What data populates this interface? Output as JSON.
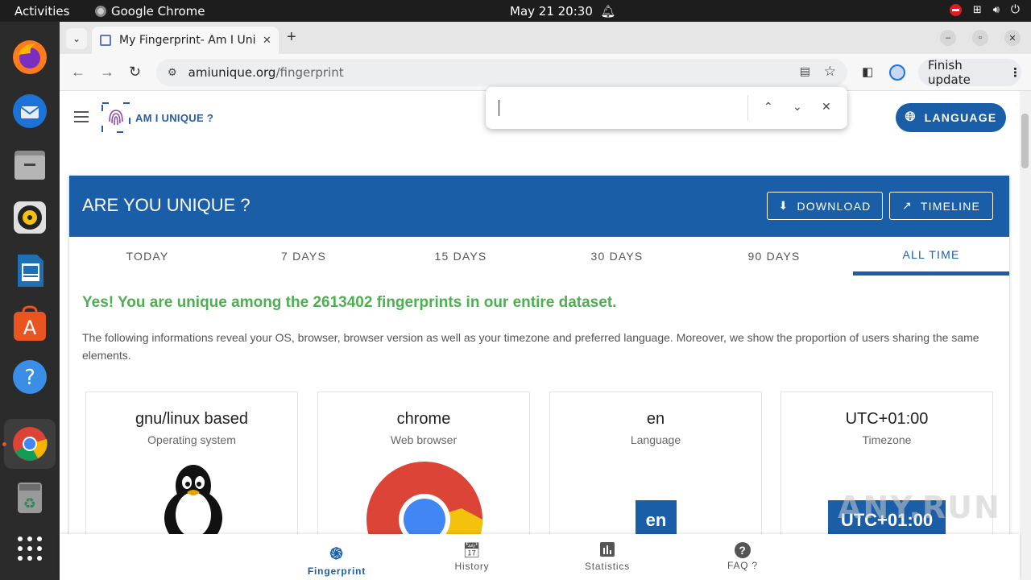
{
  "topbar": {
    "activities": "Activities",
    "app_name": "Google Chrome",
    "clock": "May 21  20:30"
  },
  "browser": {
    "tab_title": "My Fingerprint- Am I Uni",
    "url_host": "amiunique.org",
    "url_path": "/fingerprint",
    "finish_update": "Finish update"
  },
  "site": {
    "logo_text": "AM I UNIQUE ?",
    "language_label": "LANGUAGE"
  },
  "banner": {
    "title": "ARE YOU UNIQUE ?",
    "download_label": "DOWNLOAD",
    "timeline_label": "TIMELINE"
  },
  "period_tabs": [
    "TODAY",
    "7 DAYS",
    "15 DAYS",
    "30 DAYS",
    "90 DAYS",
    "ALL TIME"
  ],
  "active_tab": "ALL TIME",
  "result": {
    "headline": "Yes! You are unique among the 2613402 fingerprints in our entire dataset.",
    "description": "The following informations reveal your OS, browser, browser version as well as your timezone and preferred language. Moreover, we show the proportion of users sharing the same elements."
  },
  "cards": [
    {
      "value": "gnu/linux based",
      "label": "Operating system"
    },
    {
      "value": "chrome",
      "label": "Web browser"
    },
    {
      "value": "en",
      "label": "Language",
      "badge": "en"
    },
    {
      "value": "UTC+01:00",
      "label": "Timezone",
      "badge": "UTC+01:00"
    }
  ],
  "bottom_nav": [
    {
      "label": "Fingerprint",
      "icon": "fingerprint-icon"
    },
    {
      "label": "History",
      "icon": "history-icon"
    },
    {
      "label": "Statistics",
      "icon": "statistics-icon"
    },
    {
      "label": "FAQ ?",
      "icon": "help-icon"
    }
  ],
  "watermark": "ANY.RUN",
  "colors": {
    "brand_blue": "#1a5ea8",
    "success_green": "#4caf50",
    "logo_purple": "#8e4bb0"
  }
}
